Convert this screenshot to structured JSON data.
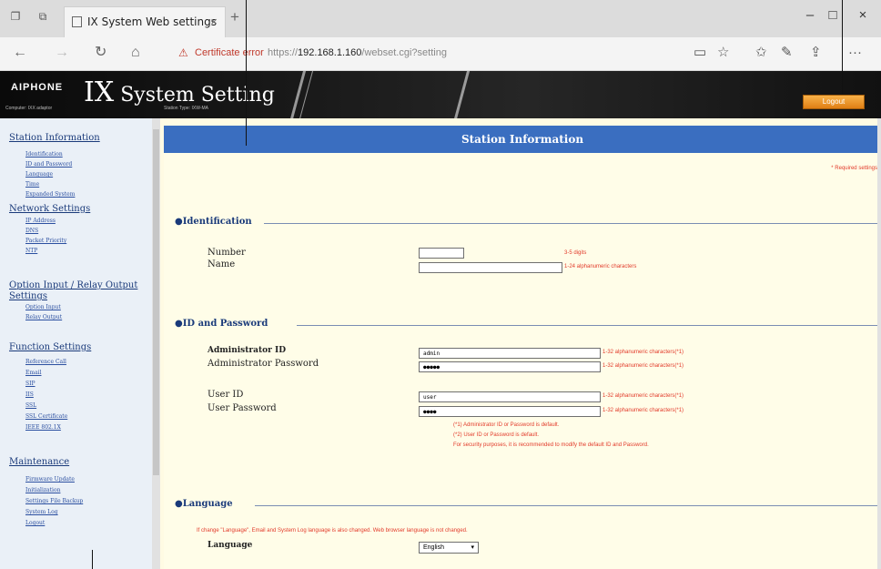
{
  "browser": {
    "tab_title": "IX System Web settings",
    "tab_close": "×",
    "new_tab": "+",
    "win_minimize": "–",
    "win_restore": "□",
    "win_close": "×",
    "cert_warning": "Certificate error",
    "url_prefix": "https://",
    "url_host": "192.168.1.160",
    "url_path": "/webset.cgi?setting",
    "icons": [
      "back-arrow-icon",
      "forward-arrow-icon",
      "refresh-icon",
      "home-icon",
      "warning-icon",
      "reading-view-icon",
      "favorite-star-icon",
      "favorites-bar-icon",
      "pen-icon",
      "share-icon",
      "more-icon"
    ]
  },
  "header": {
    "brand": "AIPHONE",
    "title_big": "IX",
    "title_rest": " System Setting",
    "sub_left": "Computer: IXX adaptor",
    "sub_mid": "Station Type: IXW-MA",
    "logout_label": "Logout"
  },
  "sidebar": {
    "sections": [
      {
        "label": "Station Information",
        "items": [
          "Identification",
          "ID and Password",
          "Language",
          "Time",
          "Expanded System"
        ]
      },
      {
        "label": "Network Settings",
        "items": [
          "IP Address",
          "DNS",
          "Packet Priority",
          "NTP"
        ]
      },
      {
        "label": "Option Input / Relay Output Settings",
        "items": [
          "Option Input",
          "Relay Output"
        ]
      },
      {
        "label": "Function Settings",
        "items": [
          "Reference Call",
          "Email",
          "SIP",
          "IIS",
          "SSL",
          "SSL Certificate",
          "IEEE 802.1X"
        ]
      },
      {
        "label": "Maintenance",
        "items": [
          "Firmware Update",
          "Initialization",
          "Settings File Backup",
          "System Log",
          "Logout"
        ]
      }
    ]
  },
  "main": {
    "page_title": "Station Information",
    "required_note": "* Required settings",
    "identification": {
      "heading": "Identification",
      "number_label": "Number",
      "number_value": "",
      "number_hint": "3-5 digits",
      "name_label": "Name",
      "name_value": "",
      "name_hint": "1-24 alphanumeric characters"
    },
    "id_password": {
      "heading": "ID and Password",
      "admin_id_label": "Administrator ID",
      "admin_id_value": "admin",
      "admin_id_hint": "1-32 alphanumeric characters(*1)",
      "admin_pw_label": "Administrator Password",
      "admin_pw_value": "●●●●●",
      "admin_pw_hint": "1-32 alphanumeric characters(*1)",
      "user_id_label": "User ID",
      "user_id_value": "user",
      "user_id_hint": "1-32 alphanumeric characters(*1)",
      "user_pw_label": "User Password",
      "user_pw_value": "●●●●",
      "user_pw_hint": "1-32 alphanumeric characters(*1)",
      "notes": [
        "(*1) Administrator ID or Password is default.",
        "(*2) User ID or Password is default.",
        "For security purposes, it is recommended to modify the default ID and Password."
      ]
    },
    "language": {
      "heading": "Language",
      "note": "If change \"Language\", Email and System Log language is also changed. Web browser language is not changed.",
      "label": "Language",
      "value": "English"
    }
  }
}
